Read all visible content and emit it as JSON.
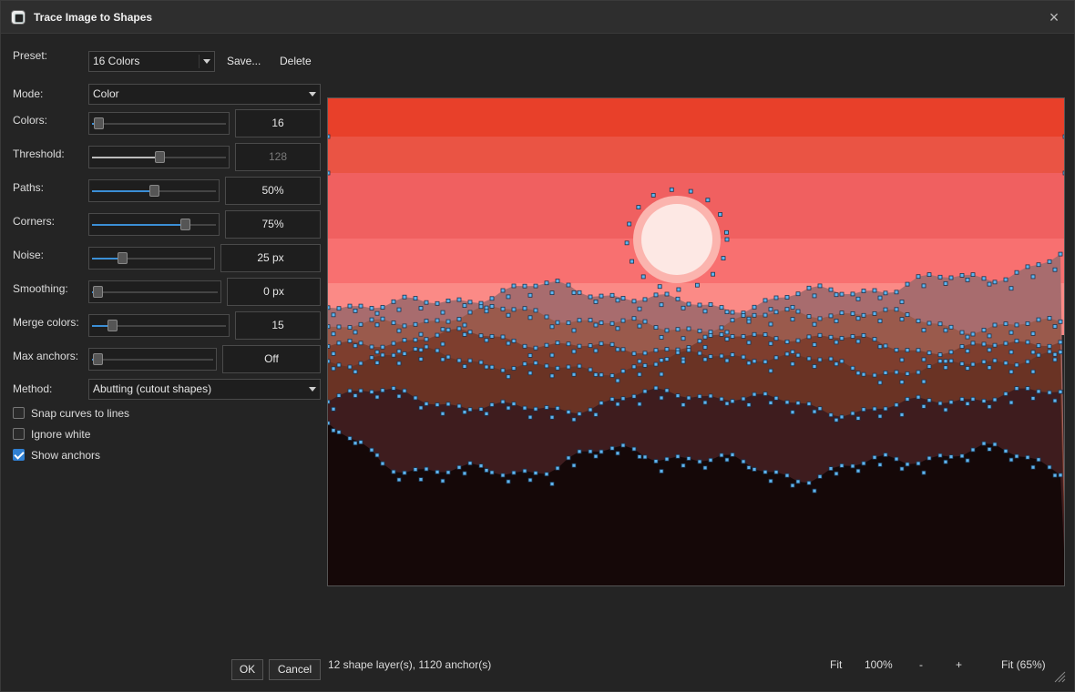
{
  "window": {
    "title": "Trace Image to Shapes",
    "close_glyph": "×",
    "icon": "app-icon"
  },
  "preset": {
    "label": "Preset:",
    "value": "16 Colors",
    "save": "Save...",
    "delete": "Delete"
  },
  "mode": {
    "label": "Mode:",
    "value": "Color"
  },
  "sliders": {
    "colors": {
      "label": "Colors:",
      "value": "16",
      "level": 0.05,
      "disabled": false
    },
    "threshold": {
      "label": "Threshold:",
      "value": "128",
      "level": 0.5,
      "disabled": true
    },
    "paths": {
      "label": "Paths:",
      "value": "50%",
      "level": 0.5,
      "disabled": false
    },
    "corners": {
      "label": "Corners:",
      "value": "75%",
      "level": 0.75,
      "disabled": false
    },
    "noise": {
      "label": "Noise:",
      "value": "25 px",
      "level": 0.25,
      "disabled": false
    },
    "smoothing": {
      "label": "Smoothing:",
      "value": "0 px",
      "level": 0.0,
      "disabled": false
    },
    "merge": {
      "label": "Merge colors:",
      "value": "15",
      "level": 0.15,
      "disabled": false
    },
    "anchors": {
      "label": "Max anchors:",
      "value": "Off",
      "level": 0.0,
      "disabled": false
    }
  },
  "method": {
    "label": "Method:",
    "value": "Abutting (cutout shapes)"
  },
  "checkboxes": {
    "snap": {
      "label": "Snap curves to lines",
      "checked": false
    },
    "ignore": {
      "label": "Ignore white",
      "checked": false
    },
    "show": {
      "label": "Show anchors",
      "checked": true
    }
  },
  "footer": {
    "ok": "OK",
    "cancel": "Cancel",
    "status": "12 shape layer(s), 1120 anchor(s)",
    "fit": "Fit",
    "zoom100": "100%",
    "zoom_out": "-",
    "zoom_in": "+",
    "fit_pct": "Fit (65%)"
  },
  "colors": {
    "accent": "#3b8fd6",
    "anchor": "#5fb4ee",
    "sky": [
      "#e8402a",
      "#ea5444",
      "#f06060",
      "#f87070",
      "#fb8a86"
    ],
    "sun_halo": "#fbb4ae",
    "sun": "#fde8e4",
    "layers": [
      "#a86c6e",
      "#9a5a4c",
      "#7e3e2e",
      "#6a3324",
      "#3e1c1e",
      "#150808"
    ]
  }
}
